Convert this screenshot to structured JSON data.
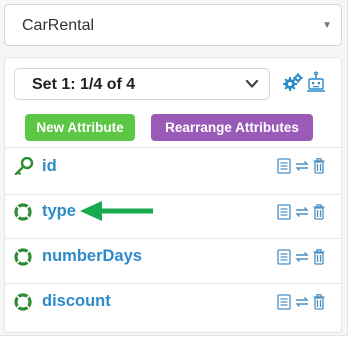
{
  "model_selector": {
    "value": "CarRental"
  },
  "set_selector": {
    "value": "Set 1: 1/4 of 4"
  },
  "buttons": {
    "new_attribute": "New Attribute",
    "rearrange": "Rearrange Attributes"
  },
  "attributes": [
    {
      "name": "id",
      "icon": "key-icon"
    },
    {
      "name": "type",
      "icon": "lifebuoy-icon"
    },
    {
      "name": "numberDays",
      "icon": "lifebuoy-icon"
    },
    {
      "name": "discount",
      "icon": "lifebuoy-icon"
    }
  ],
  "colors": {
    "accent_blue": "#2d8bc9",
    "key_green": "#2e8b36",
    "new_button": "#5cc645",
    "rearrange_button": "#9a5ab8",
    "arrow_green": "#17a94c"
  }
}
